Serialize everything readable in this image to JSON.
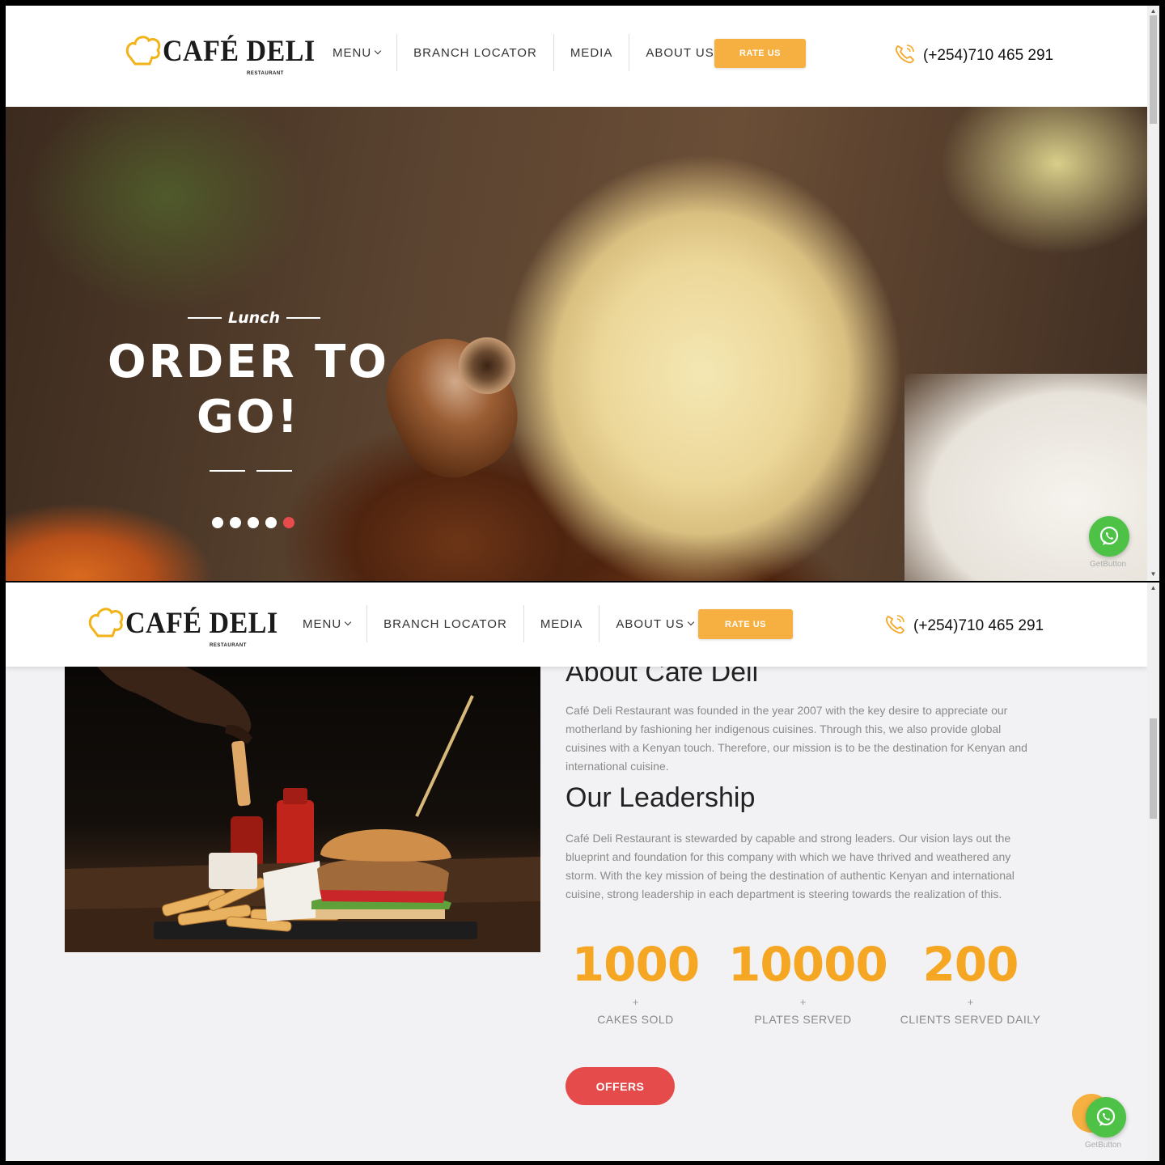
{
  "brand": {
    "name": "CAFÉ DELI",
    "sub": "RESTAURANT"
  },
  "nav": {
    "items": [
      {
        "label": "MENU",
        "dropdown": true
      },
      {
        "label": "BRANCH LOCATOR",
        "dropdown": false
      },
      {
        "label": "MEDIA",
        "dropdown": false
      },
      {
        "label": "ABOUT US",
        "dropdown": true
      }
    ],
    "rate_label": "RATE US",
    "phone": "(+254)710 465 291"
  },
  "hero": {
    "kicker": "Lunch",
    "title_line1": "ORDER TO",
    "title_line2": "GO!",
    "slides_total": 5,
    "active_slide": 5
  },
  "widget": {
    "label": "GetButton"
  },
  "about": {
    "title": "About Cafe Deli",
    "text": "Café Deli Restaurant was founded in the year 2007 with the key desire to appreciate our motherland by fashioning her indigenous cuisines. Through this, we also provide global cuisines with a Kenyan touch. Therefore, our mission is to be the destination for Kenyan and international cuisine.",
    "leadership_title": "Our Leadership",
    "leadership_text": "Café Deli Restaurant is stewarded by capable and strong leaders. Our vision lays out the blueprint and foundation for this company with which we have thrived and weathered any storm. With the key mission of being the destination of authentic Kenyan and international cuisine, strong leadership in each department is steering towards the realization of this."
  },
  "stats": [
    {
      "value": "1000",
      "plus": "+",
      "label": "CAKES SOLD"
    },
    {
      "value": "10000",
      "plus": "+",
      "label": "PLATES SERVED"
    },
    {
      "value": "200",
      "plus": "+",
      "label": "CLIENTS SERVED DAILY"
    }
  ],
  "offers_label": "OFFERS",
  "colors": {
    "accent": "#f5a623",
    "rate_button": "#f5b041",
    "offers": "#e54b4b",
    "whatsapp": "#4dc247"
  }
}
